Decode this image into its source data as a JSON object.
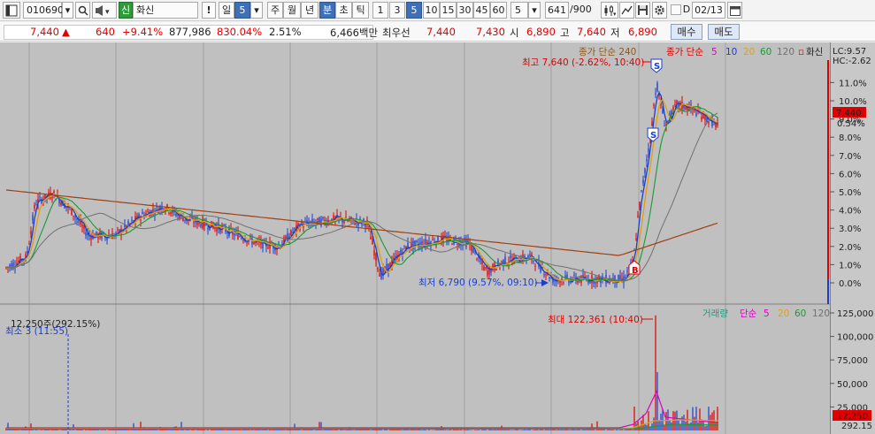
{
  "toolbar": {
    "code": "010690",
    "badge": "신",
    "name": "화신",
    "warn": "!",
    "day_label": "일",
    "day_value": "5",
    "week": "주",
    "month": "월",
    "year": "년",
    "minute": "분",
    "second": "초",
    "tick": "틱",
    "intervals": [
      "1",
      "3",
      "5",
      "10",
      "15",
      "30",
      "45",
      "60"
    ],
    "interval_selected": "5",
    "count_select": "5",
    "page_value": "641",
    "page_total": "/900",
    "d_label": "D",
    "date": "02/13"
  },
  "quote": {
    "price": "7,440",
    "arrow": "▲",
    "change": "640",
    "change_pct": "+9.41%",
    "volume": "877,986",
    "vol_ratio": "830.04%",
    "turnover": "2.51%",
    "amount": "6,466백만",
    "best_label": "최우선",
    "ask": "7,440",
    "bid": "7,430",
    "open_label": "시",
    "open": "6,890",
    "high_label": "고",
    "high": "7,640",
    "low_label": "저",
    "low": "6,890",
    "buy_button": "매수",
    "sell_button": "매도"
  },
  "price_panel": {
    "legend_close": "종가 단순 240",
    "legend_ma_prefix": "종가 단순",
    "ma_periods": [
      "5",
      "10",
      "20",
      "60",
      "120"
    ],
    "stock_name": "화신",
    "lc_label": "LC:9.57",
    "hc_label": "HC:-2.62",
    "high_annotation": "최고 7,640 (-2.62%, 10:40)",
    "low_annotation": "최저 6,790 (9.57%, 09:10)",
    "current_price_tag": "7,440",
    "current_pct_tag": "0.54%",
    "signal_s": "S",
    "signal_b": "B",
    "y_ticks": [
      "11.0%",
      "10.0%",
      "9.0%",
      "8.0%",
      "7.0%",
      "6.0%",
      "5.0%",
      "4.0%",
      "3.0%",
      "2.0%",
      "1.0%",
      "0.0%"
    ]
  },
  "volume_panel": {
    "legend_title": "거래량",
    "legend_ma_prefix": "단순",
    "ma_periods": [
      "5",
      "20",
      "60",
      "120"
    ],
    "left_annotation": "12,250주(292.15%)",
    "min_annotation": "최소 3 (11:55)",
    "max_annotation": "최대 122,361 (10:40)",
    "current_vol_tag": "12,250",
    "current_vol_pct": "292.15",
    "y_ticks": [
      "125,000",
      "100,000",
      "75,000",
      "50,000",
      "25,000"
    ]
  },
  "colors": {
    "ma5": "#1a3ed0",
    "ma10": "#e0a010",
    "ma20": "#1a9a30",
    "ma60": "#707070",
    "ma120": "#a04010",
    "up": "#e00000",
    "down": "#1a3ed0",
    "panel_bg": "#c0c0c0"
  }
}
